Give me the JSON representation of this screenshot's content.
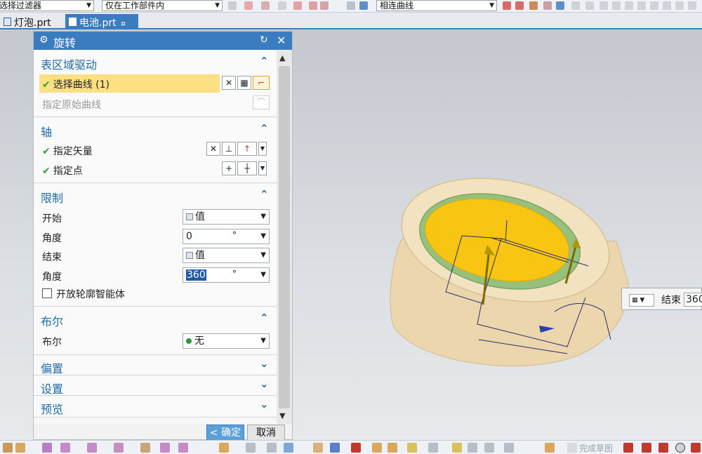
{
  "toolbar": {
    "filter_label": "选择过滤器",
    "scope_label": "仅在工作部件内",
    "curve_rule_label": "相连曲线"
  },
  "tabs": [
    {
      "label": "灯泡.prt",
      "active": false
    },
    {
      "label": "电池.prt",
      "active": true,
      "modified_mark": "¤"
    }
  ],
  "dialog": {
    "title": "旋转",
    "sections": {
      "surface_drive": {
        "header": "表区域驱动",
        "select_curve": "选择曲线 (1)",
        "specify_original_curve": "指定原始曲线"
      },
      "axis": {
        "header": "轴",
        "specify_vector": "指定矢量",
        "specify_point": "指定点"
      },
      "limits": {
        "header": "限制",
        "start_label": "开始",
        "start_type": "值",
        "start_angle_label": "角度",
        "start_angle_value": "0",
        "start_angle_unit": "°",
        "end_label": "结束",
        "end_type": "值",
        "end_angle_label": "角度",
        "end_angle_value": "360",
        "end_angle_unit": "°",
        "open_profile_label": "开放轮廓智能体",
        "open_profile_checked": false
      },
      "boolean": {
        "header": "布尔",
        "label": "布尔",
        "value": "无"
      },
      "offset": {
        "header": "偏置"
      },
      "settings": {
        "header": "设置"
      },
      "preview": {
        "header": "预览"
      }
    },
    "ok_label": "< 确定 >",
    "cancel_label": "取消"
  },
  "floating_input": {
    "label": "结束",
    "value": "360"
  },
  "bottom_toolbar": {
    "finish_sketch_label": "完成草图"
  },
  "colors": {
    "accent": "#3b7bbf",
    "section_header": "#1f6aa5",
    "highlight_row": "#fde083",
    "check_green": "#2fa52f",
    "model_body": "#efdcb4",
    "model_face": "#f7c512",
    "model_ring": "#8fbf7a"
  }
}
